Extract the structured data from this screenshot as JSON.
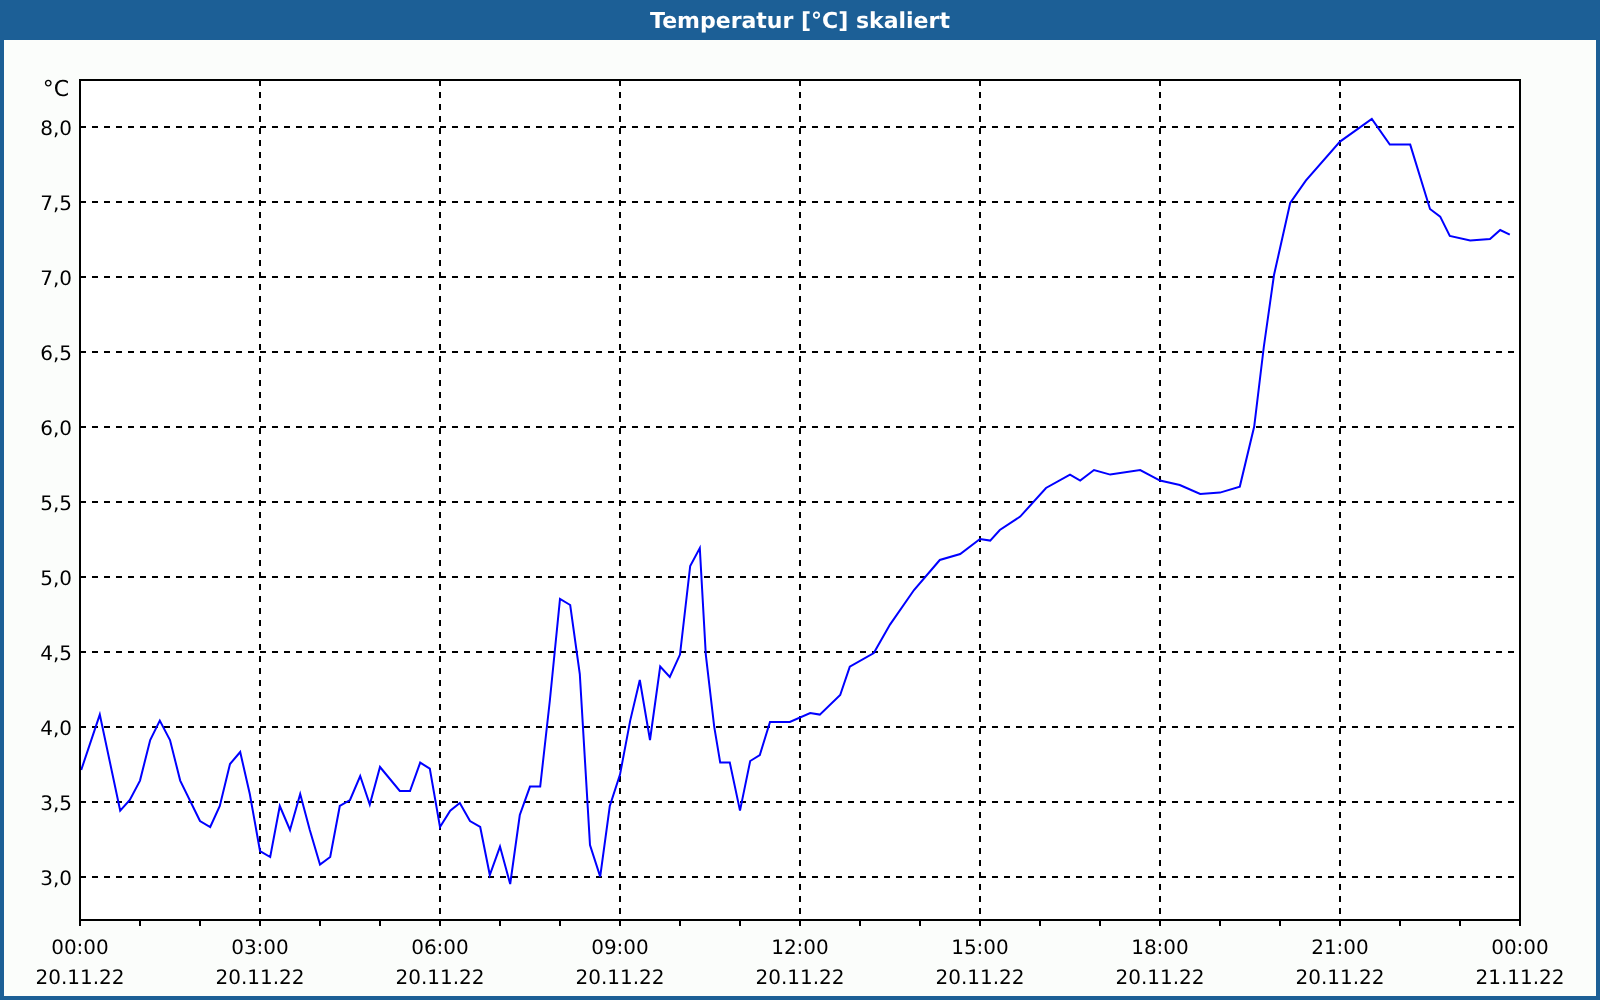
{
  "window": {
    "title": "Temperatur [°C] skaliert"
  },
  "chart": {
    "chart_data": {
      "type": "line",
      "grid": true,
      "ylabel": "°C",
      "xlim": [
        0,
        24
      ],
      "ylim": [
        2.71,
        8.31
      ],
      "xticks": [
        {
          "value": 0,
          "label": "00:00"
        },
        {
          "value": 3,
          "label": "03:00"
        },
        {
          "value": 6,
          "label": "06:00"
        },
        {
          "value": 9,
          "label": "09:00"
        },
        {
          "value": 12,
          "label": "12:00"
        },
        {
          "value": 15,
          "label": "15:00"
        },
        {
          "value": 18,
          "label": "18:00"
        },
        {
          "value": 21,
          "label": "21:00"
        },
        {
          "value": 24,
          "label": "00:00"
        }
      ],
      "annotations": [
        "20.11.22",
        "20.11.22",
        "20.11.22",
        "20.11.22",
        "20.11.22",
        "20.11.22",
        "20.11.22",
        "20.11.22",
        "21.11.22"
      ],
      "yticks": [
        {
          "value": 3,
          "label": "3,0"
        },
        {
          "value": 3.5,
          "label": "3,5"
        },
        {
          "value": 4,
          "label": "4,0"
        },
        {
          "value": 4.5,
          "label": "4,5"
        },
        {
          "value": 5,
          "label": "5,0"
        },
        {
          "value": 5.5,
          "label": "5,5"
        },
        {
          "value": 6,
          "label": "6,0"
        },
        {
          "value": 6.5,
          "label": "6,5"
        },
        {
          "value": 7,
          "label": "7,0"
        },
        {
          "value": 7.5,
          "label": "7,5"
        },
        {
          "value": 8,
          "label": "8,0"
        }
      ],
      "x": [
        0.02,
        0.33,
        0.67,
        0.83,
        1.0,
        1.17,
        1.33,
        1.5,
        1.67,
        2.0,
        2.17,
        2.33,
        2.5,
        2.67,
        2.83,
        3.0,
        3.17,
        3.33,
        3.5,
        3.67,
        3.83,
        4.0,
        4.17,
        4.33,
        4.5,
        4.67,
        4.83,
        5.0,
        5.33,
        5.5,
        5.67,
        5.83,
        6.0,
        6.17,
        6.33,
        6.5,
        6.67,
        6.83,
        7.0,
        7.17,
        7.33,
        7.5,
        7.67,
        7.83,
        8.0,
        8.17,
        8.33,
        8.5,
        8.67,
        8.83,
        9.0,
        9.17,
        9.33,
        9.5,
        9.67,
        9.83,
        10.0,
        10.17,
        10.33,
        10.43,
        10.57,
        10.67,
        10.83,
        11.0,
        11.17,
        11.33,
        11.5,
        11.83,
        12.17,
        12.33,
        12.67,
        12.83,
        13.23,
        13.5,
        13.9,
        14.33,
        14.67,
        15.0,
        15.17,
        15.33,
        15.67,
        16.1,
        16.5,
        16.67,
        16.9,
        17.17,
        17.67,
        18.0,
        18.33,
        18.67,
        19.0,
        19.33,
        19.57,
        19.73,
        19.9,
        20.17,
        20.43,
        21.0,
        21.53,
        21.83,
        22.17,
        22.5,
        22.67,
        22.83,
        23.17,
        23.5,
        23.67,
        23.83
      ],
      "series": [
        {
          "color": "#0000ff",
          "values": [
            3.71,
            4.08,
            3.44,
            3.51,
            3.64,
            3.91,
            4.04,
            3.91,
            3.64,
            3.37,
            3.33,
            3.47,
            3.75,
            3.83,
            3.55,
            3.17,
            3.13,
            3.47,
            3.31,
            3.55,
            3.31,
            3.08,
            3.13,
            3.47,
            3.51,
            3.67,
            3.48,
            3.73,
            3.57,
            3.57,
            3.76,
            3.72,
            3.33,
            3.44,
            3.49,
            3.37,
            3.33,
            3.01,
            3.2,
            2.95,
            3.41,
            3.6,
            3.6,
            4.17,
            4.85,
            4.81,
            4.35,
            3.21,
            3.0,
            3.47,
            3.68,
            4.04,
            4.31,
            3.91,
            4.4,
            4.33,
            4.48,
            5.07,
            5.19,
            4.48,
            4.0,
            3.76,
            3.76,
            3.44,
            3.77,
            3.81,
            4.03,
            4.03,
            4.09,
            4.08,
            4.21,
            4.4,
            4.49,
            4.68,
            4.91,
            5.11,
            5.15,
            5.25,
            5.24,
            5.31,
            5.4,
            5.59,
            5.68,
            5.64,
            5.71,
            5.68,
            5.71,
            5.64,
            5.61,
            5.55,
            5.56,
            5.6,
            6.0,
            6.53,
            7.01,
            7.49,
            7.64,
            7.9,
            8.05,
            7.88,
            7.88,
            7.45,
            7.4,
            7.27,
            7.24,
            7.25,
            7.31,
            7.28
          ]
        }
      ]
    }
  }
}
